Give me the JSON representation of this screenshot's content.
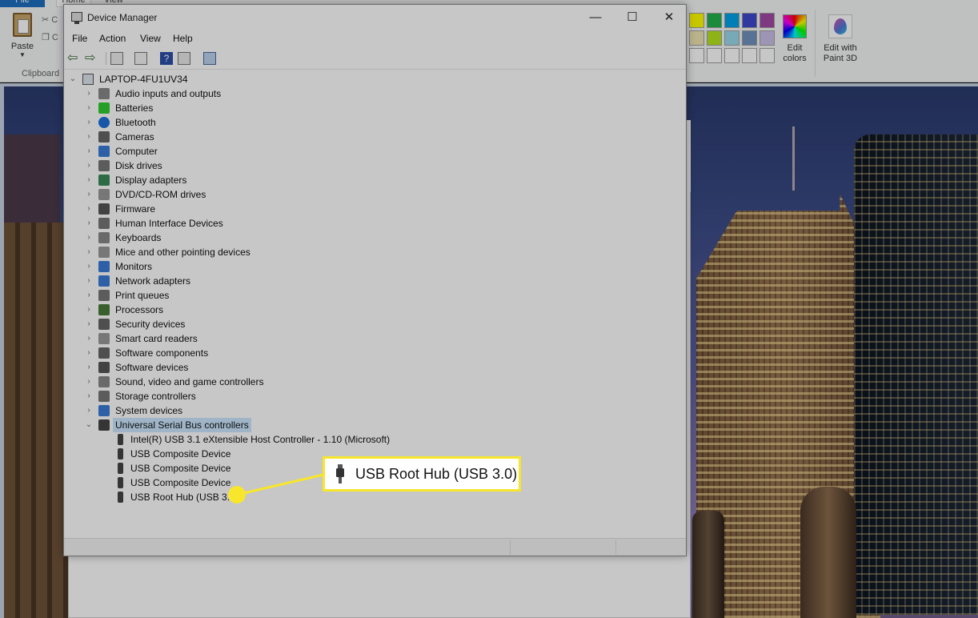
{
  "paint": {
    "tabs": [
      "File",
      "Home",
      "View"
    ],
    "paste_label": "Paste",
    "clipboard_group_label": "Clipboard",
    "cut_label": "C",
    "copy_label": "C",
    "edit_colors_label": "Edit colors",
    "edit_3d_label": "Edit with Paint 3D",
    "palette_colors": [
      "#ffff00",
      "#22b14c",
      "#00a2e8",
      "#3f48cc",
      "#a349a4",
      "#efe4b0",
      "#b5e61d",
      "#99d9ea",
      "#7092be",
      "#c8bfe7"
    ]
  },
  "window": {
    "title": "Device Manager",
    "minimize_glyph": "—",
    "maximize_glyph": "☐",
    "close_glyph": "✕"
  },
  "menu": [
    "File",
    "Action",
    "View",
    "Help"
  ],
  "toolbar": {
    "back_glyph": "⇦",
    "forward_glyph": "⇨"
  },
  "tree": {
    "root": "LAPTOP-4FU1UV34",
    "categories": [
      {
        "label": "Audio inputs and outputs",
        "icon": "speaker-icon"
      },
      {
        "label": "Batteries",
        "icon": "battery-icon"
      },
      {
        "label": "Bluetooth",
        "icon": "bluetooth-icon"
      },
      {
        "label": "Cameras",
        "icon": "camera-icon"
      },
      {
        "label": "Computer",
        "icon": "computer-icon"
      },
      {
        "label": "Disk drives",
        "icon": "disk-drive-icon"
      },
      {
        "label": "Display adapters",
        "icon": "display-adapter-icon"
      },
      {
        "label": "DVD/CD-ROM drives",
        "icon": "dvd-icon"
      },
      {
        "label": "Firmware",
        "icon": "firmware-icon"
      },
      {
        "label": "Human Interface Devices",
        "icon": "hid-icon"
      },
      {
        "label": "Keyboards",
        "icon": "keyboard-icon"
      },
      {
        "label": "Mice and other pointing devices",
        "icon": "mouse-icon"
      },
      {
        "label": "Monitors",
        "icon": "monitor-icon"
      },
      {
        "label": "Network adapters",
        "icon": "network-icon"
      },
      {
        "label": "Print queues",
        "icon": "printer-icon"
      },
      {
        "label": "Processors",
        "icon": "processor-icon"
      },
      {
        "label": "Security devices",
        "icon": "security-icon"
      },
      {
        "label": "Smart card readers",
        "icon": "smart-card-icon"
      },
      {
        "label": "Software components",
        "icon": "software-component-icon"
      },
      {
        "label": "Software devices",
        "icon": "software-device-icon"
      },
      {
        "label": "Sound, video and game controllers",
        "icon": "sound-icon"
      },
      {
        "label": "Storage controllers",
        "icon": "storage-icon"
      },
      {
        "label": "System devices",
        "icon": "system-icon"
      },
      {
        "label": "Universal Serial Bus controllers",
        "icon": "usb-icon",
        "expanded": true,
        "selected": true
      }
    ],
    "usb_children": [
      "Intel(R) USB 3.1 eXtensible Host Controller - 1.10 (Microsoft)",
      "USB Composite Device",
      "USB Composite Device",
      "USB Composite Device",
      "USB Root Hub (USB 3.0)"
    ]
  },
  "callout": {
    "text": "USB Root Hub (USB 3.0)",
    "color": "#f7e62c"
  }
}
